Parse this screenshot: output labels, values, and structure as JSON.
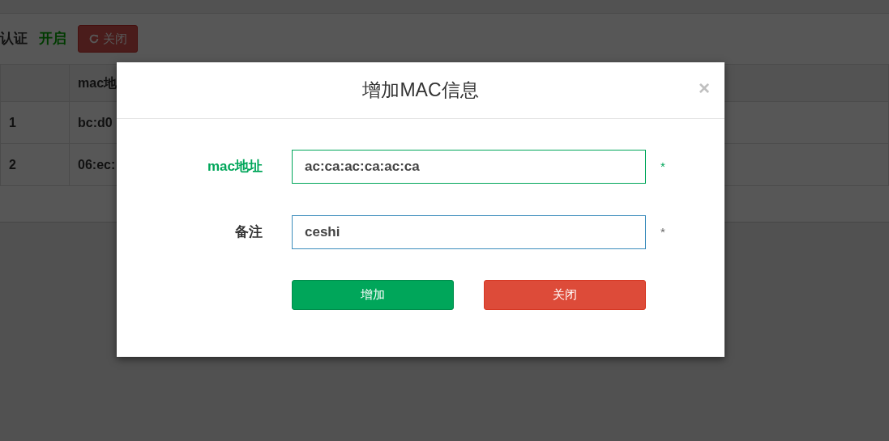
{
  "toolbar": {
    "label": "认证",
    "status": "开启",
    "status_on": true,
    "button": "关闭"
  },
  "table": {
    "columns": [
      "",
      "mac地"
    ],
    "rows": [
      [
        "1",
        "bc:d0"
      ],
      [
        "2",
        "06:ec:"
      ]
    ]
  },
  "modal": {
    "title": "增加MAC信息",
    "close": "×",
    "fields": [
      {
        "label": "mac地址",
        "value": "ac:ca:ac:ca:ac:ca",
        "required": "*",
        "valid": true,
        "focused": false
      },
      {
        "label": "备注",
        "value": "ceshi",
        "required": "*",
        "valid": false,
        "focused": true
      }
    ],
    "buttons": [
      {
        "label": "增加",
        "kind": "primary"
      },
      {
        "label": "关闭",
        "kind": "danger"
      }
    ]
  }
}
